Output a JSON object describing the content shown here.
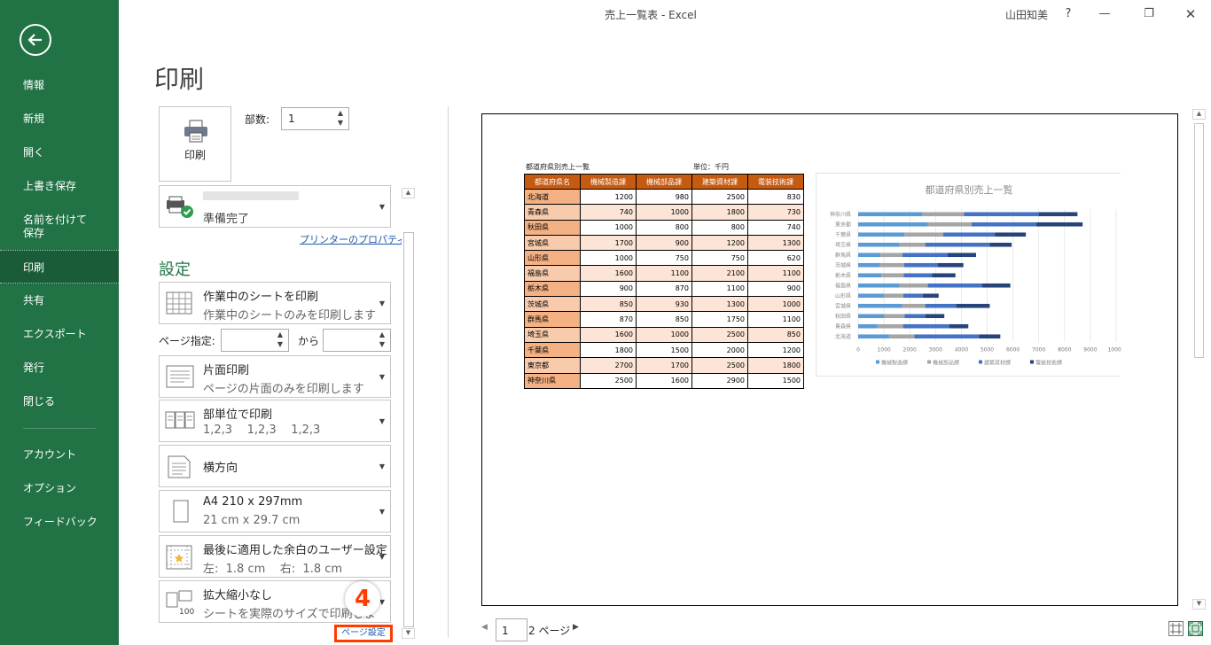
{
  "window": {
    "title": "売上一覧表 - Excel",
    "user": "山田知美",
    "help": "?"
  },
  "sidebar": {
    "items": [
      "情報",
      "新規",
      "開く",
      "上書き保存",
      "名前を付けて\n保存",
      "印刷",
      "共有",
      "エクスポート",
      "発行",
      "閉じる",
      "アカウント",
      "オプション",
      "フィードバック"
    ]
  },
  "page": {
    "heading": "印刷"
  },
  "print": {
    "button": "印刷",
    "copies_label": "部数:",
    "copies": "1"
  },
  "printer": {
    "status": "準備完了",
    "properties_link": "プリンターのプロパティ"
  },
  "settings": {
    "heading": "設定",
    "items": [
      {
        "title": "作業中のシートを印刷",
        "sub": "作業中のシートのみを印刷します",
        "icon": "sheet-grid-icon"
      },
      {
        "title": "片面印刷",
        "sub": "ページの片面のみを印刷します",
        "icon": "one-sided-icon"
      },
      {
        "title": "部単位で印刷",
        "sub": "1,2,3    1,2,3    1,2,3",
        "icon": "collated-icon"
      },
      {
        "title": "横方向",
        "sub": "",
        "icon": "landscape-icon"
      },
      {
        "title": "A4 210 x 297mm",
        "sub": "21 cm x 29.7 cm",
        "icon": "paper-size-icon"
      },
      {
        "title": "最後に適用した余白のユーザー設定",
        "sub": "左:  1.8 cm    右:  1.8 cm",
        "icon": "margins-icon"
      },
      {
        "title": "拡大縮小なし",
        "sub": "シートを実際のサイズで印刷しま",
        "icon": "scaling-icon"
      }
    ],
    "page_range_label": "ページ指定:",
    "page_range_to": "から",
    "page_setup_link": "ページ設定",
    "callout_number": "4"
  },
  "preview": {
    "sheet_title": "都道府県別売上一覧",
    "unit": "単位：千円",
    "page_current": "1",
    "page_total": "2 ページ"
  },
  "table": {
    "headers": [
      "都道府県名",
      "機械製造課",
      "機械部品課",
      "建築資材課",
      "電装技術課"
    ],
    "rows": [
      [
        "北海道",
        "1200",
        "980",
        "2500",
        "830"
      ],
      [
        "青森県",
        "740",
        "1000",
        "1800",
        "730"
      ],
      [
        "秋田県",
        "1000",
        "800",
        "800",
        "740"
      ],
      [
        "宮城県",
        "1700",
        "900",
        "1200",
        "1300"
      ],
      [
        "山形県",
        "1000",
        "750",
        "750",
        "620"
      ],
      [
        "福島県",
        "1600",
        "1100",
        "2100",
        "1100"
      ],
      [
        "栃木県",
        "900",
        "870",
        "1100",
        "900"
      ],
      [
        "茨城県",
        "850",
        "930",
        "1300",
        "1000"
      ],
      [
        "群馬県",
        "870",
        "850",
        "1750",
        "1100"
      ],
      [
        "埼玉県",
        "1600",
        "1000",
        "2500",
        "850"
      ],
      [
        "千葉県",
        "1800",
        "1500",
        "2000",
        "1200"
      ],
      [
        "東京都",
        "2700",
        "1700",
        "2500",
        "1800"
      ],
      [
        "神奈川県",
        "2500",
        "1600",
        "2900",
        "1500"
      ]
    ]
  },
  "chart_data": {
    "type": "bar",
    "stacked": true,
    "orientation": "horizontal",
    "title": "都道府県別売上一覧",
    "categories": [
      "神奈川県",
      "東京都",
      "千葉県",
      "埼玉県",
      "群馬県",
      "茨城県",
      "栃木県",
      "福島県",
      "山形県",
      "宮城県",
      "秋田県",
      "青森県",
      "北海道"
    ],
    "series": [
      {
        "name": "機械製造課",
        "color": "#5b9bd5",
        "values": [
          2500,
          2700,
          1800,
          1600,
          870,
          850,
          900,
          1600,
          1000,
          1700,
          1000,
          740,
          1200
        ]
      },
      {
        "name": "機械部品課",
        "color": "#a5a5a5",
        "values": [
          1600,
          1700,
          1500,
          1000,
          850,
          930,
          870,
          1100,
          750,
          900,
          800,
          1000,
          980
        ]
      },
      {
        "name": "建築資材課",
        "color": "#4472c4",
        "values": [
          2900,
          2500,
          2000,
          2500,
          1750,
          1300,
          1100,
          2100,
          750,
          1200,
          800,
          1800,
          2500
        ]
      },
      {
        "name": "電装技術課",
        "color": "#264478",
        "values": [
          1500,
          1800,
          1200,
          850,
          1100,
          1000,
          900,
          1100,
          620,
          1300,
          740,
          730,
          830
        ]
      }
    ],
    "xlim": [
      0,
      10000
    ],
    "xticks": [
      "0",
      "1000",
      "2000",
      "3000",
      "4000",
      "5000",
      "6000",
      "7000",
      "8000",
      "9000",
      "10000"
    ],
    "grid": true,
    "legend": "bottom"
  }
}
